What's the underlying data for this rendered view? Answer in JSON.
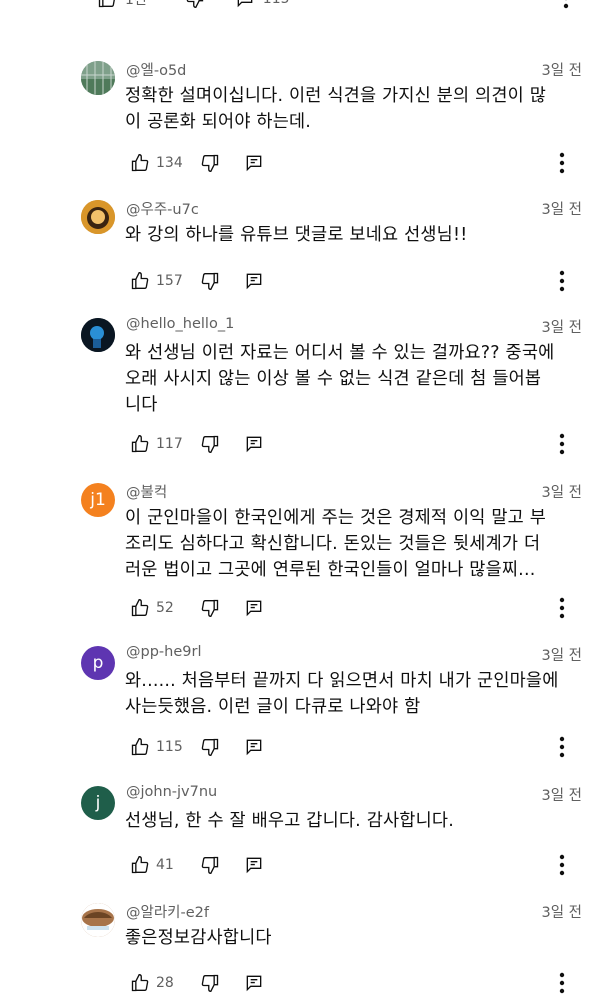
{
  "top_partial": {
    "likes": "1천",
    "replies": "115"
  },
  "comments": [
    {
      "author": "@엘-o5d",
      "time": "3일 전",
      "lines": [
        "정확한 설며이십니다. 이런 식견을 가지신 분의 의견이 많",
        "이 공론화 되어야 하는데."
      ],
      "likes": "134",
      "avatar": {
        "type": "image",
        "bg": "#6f8f7a"
      }
    },
    {
      "author": "@우주-u7c",
      "time": "3일 전",
      "lines": [
        "와 강의 하나를 유튜브 댓글로 보네요 선생님!!"
      ],
      "likes": "157",
      "avatar": {
        "type": "image",
        "bg": "#c8841e"
      }
    },
    {
      "author": "@hello_hello_1",
      "time": "3일 전",
      "lines": [
        "와 선생님 이런 자료는 어디서 볼 수 있는 걸까요?? 중국에",
        "오래 사시지 않는 이상 볼 수 없는 식견 같은데 첨 들어봅",
        "니다"
      ],
      "likes": "117",
      "avatar": {
        "type": "image",
        "bg": "#0b1a2a"
      }
    },
    {
      "author": "@불컥",
      "time": "3일 전",
      "lines": [
        "이 군인마을이 한국인에게 주는 것은 경제적 이익 말고 부",
        "조리도 심하다고 확신합니다. 돈있는 것들은 뒷세계가 더",
        "러운 법이고 그곳에 연루된 한국인들이 얼마나 많을찌..."
      ],
      "likes": "52",
      "avatar": {
        "type": "letter",
        "letter": "j1",
        "bg": "#f4811f"
      }
    },
    {
      "author": "@pp-he9rl",
      "time": "3일 전",
      "lines": [
        "와...... 처음부터 끝까지 다 읽으면서 마치 내가 군인마을에",
        "사는듯했음. 이런 글이  다큐로 나와야 함"
      ],
      "likes": "115",
      "avatar": {
        "type": "letter",
        "letter": "p",
        "bg": "#5e35b1"
      }
    },
    {
      "author": "@john-jv7nu",
      "time": "3일 전",
      "lines": [
        "선생님, 한 수 잘 배우고 갑니다. 감사합니다."
      ],
      "likes": "41",
      "avatar": {
        "type": "letter",
        "letter": "j",
        "bg": "#1f5e4a"
      }
    },
    {
      "author": "@알라키-e2f",
      "time": "3일 전",
      "lines": [
        "좋은정보감사합니다"
      ],
      "likes": "28",
      "avatar": {
        "type": "image",
        "bg": "#a8744a"
      }
    }
  ],
  "icons": {
    "like": "thumbs-up-icon",
    "dislike": "thumbs-down-icon",
    "reply": "reply-icon",
    "more": "more-vert-icon"
  },
  "colors": {
    "text": "#0f0f0f",
    "secondary": "#606060"
  }
}
